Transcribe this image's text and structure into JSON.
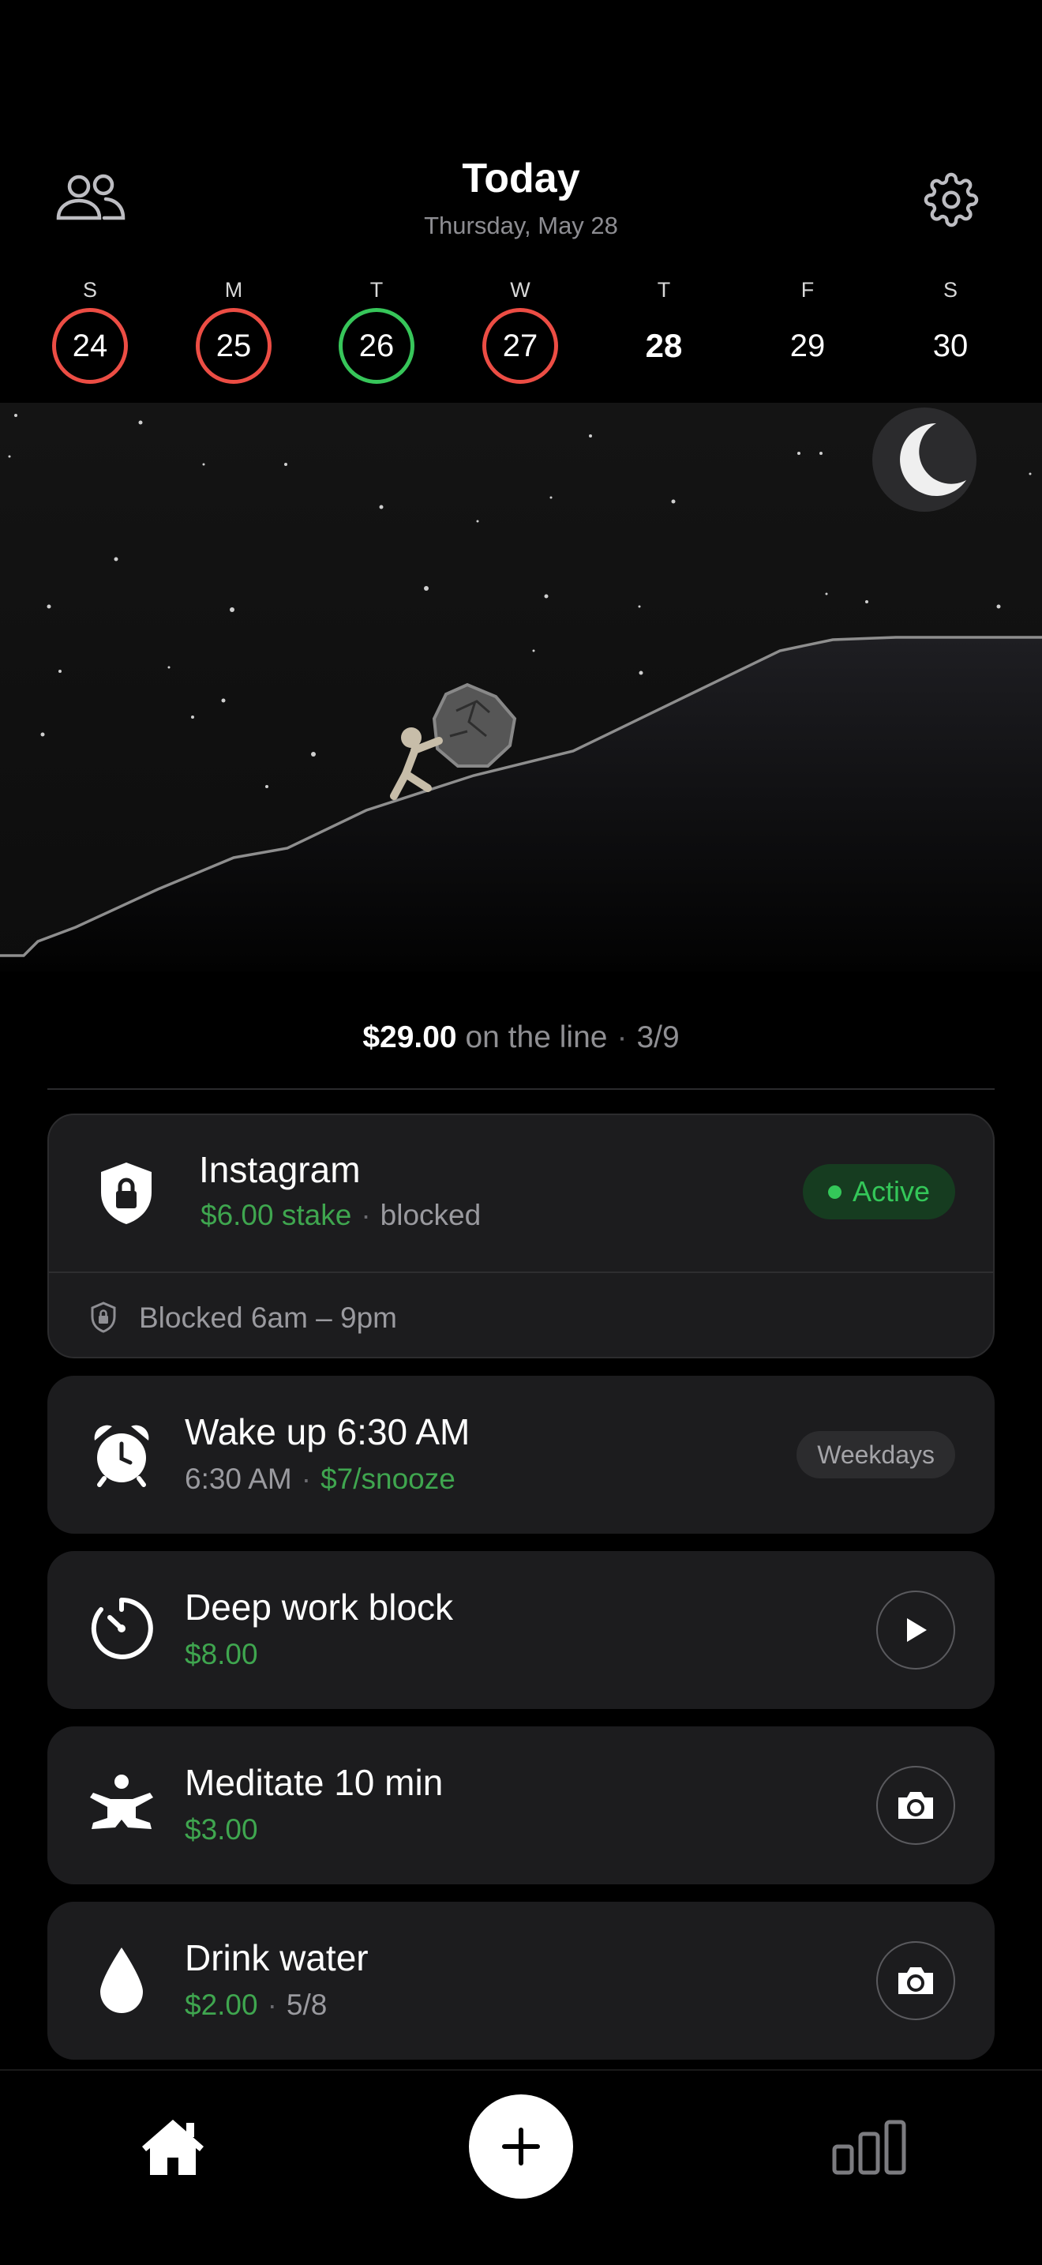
{
  "header": {
    "title": "Today",
    "subtitle": "Thursday, May 28"
  },
  "week": [
    {
      "letter": "S",
      "num": "24",
      "status": "failed"
    },
    {
      "letter": "M",
      "num": "25",
      "status": "failed"
    },
    {
      "letter": "T",
      "num": "26",
      "status": "success"
    },
    {
      "letter": "W",
      "num": "27",
      "status": "failed"
    },
    {
      "letter": "T",
      "num": "28",
      "status": "today"
    },
    {
      "letter": "F",
      "num": "29",
      "status": "upcoming"
    },
    {
      "letter": "S",
      "num": "30",
      "status": "upcoming"
    }
  ],
  "summary": {
    "amount": "$29.00",
    "label": "on the line",
    "progress": "3/9"
  },
  "cards": {
    "instagram": {
      "title": "Instagram",
      "stake": "$6.00 stake",
      "state": "blocked",
      "badge": "Active",
      "schedule": "Blocked 6am – 9pm"
    },
    "wake": {
      "title": "Wake up 6:30 AM",
      "time": "6:30 AM",
      "penalty": "$7/snooze",
      "badge": "Weekdays"
    },
    "deepwork": {
      "title": "Deep work block",
      "amount": "$8.00"
    },
    "meditate": {
      "title": "Meditate 10 min",
      "amount": "$3.00"
    },
    "water": {
      "title": "Drink water",
      "amount": "$2.00",
      "progress": "5/8"
    }
  },
  "colors": {
    "failed_ring": "#ec4d44",
    "success_ring": "#37c65a",
    "money_green": "#3fa64f",
    "active_green": "#34c759",
    "card_bg": "#1c1c1e"
  },
  "icons": {
    "header_left": "people-icon",
    "header_right": "gear-icon",
    "tab_home": "home-icon",
    "tab_add": "plus-icon",
    "tab_stats": "bar-chart-icon"
  }
}
